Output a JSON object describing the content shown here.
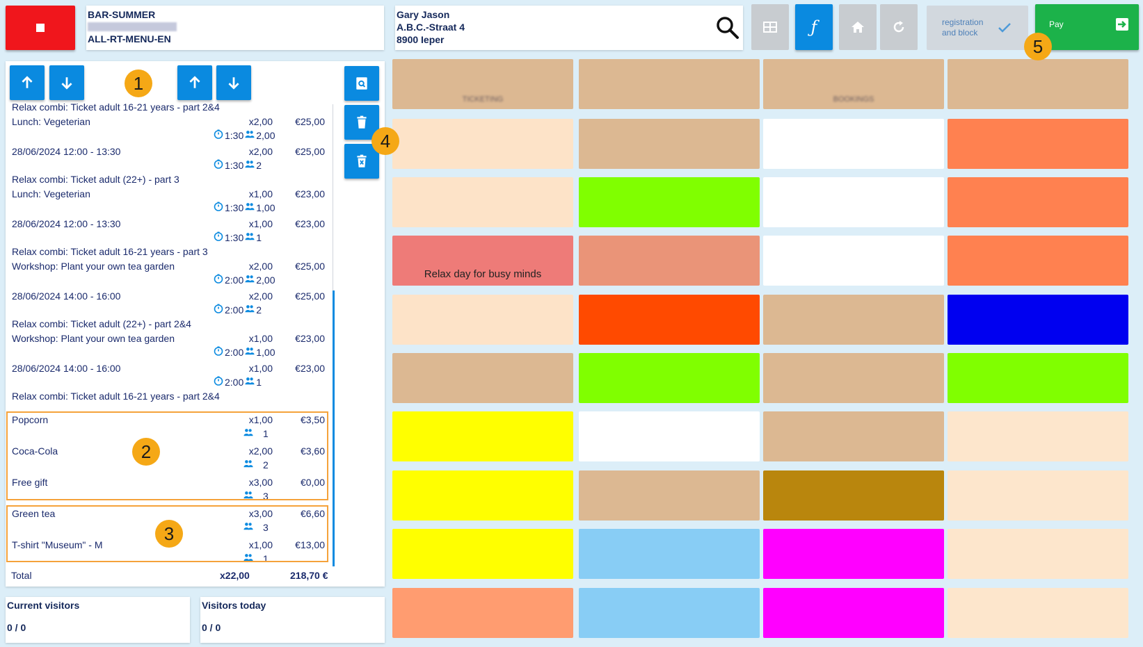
{
  "header": {
    "session_title": "BAR-SUMMER",
    "session_menu": "ALL-RT-MENU-EN",
    "customer_name": "Gary  Jason",
    "customer_street": "A.B.C.-Straat 4",
    "customer_city": "8900 Ieper",
    "registration_text_line1": "registration",
    "registration_text_line2": "and block",
    "pay_label": "Pay"
  },
  "order": {
    "lines": [
      {
        "label": "Relax combi: Ticket adult 16-21 years - part 2&4"
      },
      {
        "label": "Lunch: Vegeterian",
        "qty": "x2,00",
        "price": "€25,00",
        "time": "1:30",
        "persons": "2,00"
      },
      {
        "label": "28/06/2024 12:00 - 13:30",
        "qty": "x2,00",
        "price": "€25,00",
        "time": "1:30",
        "persons": "2"
      },
      {
        "label": "Relax combi: Ticket adult (22+) - part 3"
      },
      {
        "label": "Lunch: Vegeterian",
        "qty": "x1,00",
        "price": "€23,00",
        "time": "1:30",
        "persons": "1,00"
      },
      {
        "label": "28/06/2024 12:00 - 13:30",
        "qty": "x1,00",
        "price": "€23,00",
        "time": "1:30",
        "persons": "1"
      },
      {
        "label": "Relax combi: Ticket adult 16-21 years - part 3"
      },
      {
        "label": "Workshop: Plant your own tea garden",
        "qty": "x2,00",
        "price": "€25,00",
        "time": "2:00",
        "persons": "2,00"
      },
      {
        "label": "28/06/2024 14:00 - 16:00",
        "qty": "x2,00",
        "price": "€25,00",
        "time": "2:00",
        "persons": "2"
      },
      {
        "label": "Relax combi: Ticket adult (22+) - part 2&4"
      },
      {
        "label": "Workshop: Plant your own tea garden",
        "qty": "x1,00",
        "price": "€23,00",
        "time": "2:00",
        "persons": "1,00"
      },
      {
        "label": "28/06/2024 14:00 - 16:00",
        "qty": "x1,00",
        "price": "€23,00",
        "time": "2:00",
        "persons": "1"
      },
      {
        "label": "Relax combi: Ticket adult 16-21 years - part 2&4"
      }
    ],
    "group2": [
      {
        "label": "Popcorn",
        "qty": "x1,00",
        "price": "€3,50",
        "persons": "1"
      },
      {
        "label": "Coca-Cola",
        "qty": "x2,00",
        "price": "€3,60",
        "persons": "2"
      },
      {
        "label": "Free gift",
        "qty": "x3,00",
        "price": "€0,00",
        "persons": "3"
      }
    ],
    "group3": [
      {
        "label": "Green tea",
        "qty": "x3,00",
        "price": "€6,60",
        "persons": "3"
      },
      {
        "label": "T-shirt \"Museum\" - M",
        "qty": "x1,00",
        "price": "€13,00",
        "persons": "1"
      }
    ],
    "total_label": "Total",
    "total_qty": "x22,00",
    "total_amount": "218,70 €"
  },
  "visitors": {
    "current_label": "Current visitors",
    "current_value": "0 / 0",
    "today_label": "Visitors today",
    "today_value": "0 / 0"
  },
  "badges": [
    "1",
    "2",
    "3",
    "4",
    "5"
  ],
  "tiles": [
    {
      "label": "TICKETING",
      "color": "#dcb892"
    },
    {
      "label": "",
      "color": "#dcb892"
    },
    {
      "label": "BOOKINGS",
      "color": "#dcb892"
    },
    {
      "label": "",
      "color": "#dcb892"
    },
    {
      "label": "",
      "color": "#fde3c8"
    },
    {
      "label": "",
      "color": "#dcb892"
    },
    {
      "label": "",
      "color": "#ffffff"
    },
    {
      "label": "",
      "color": "#ff8150"
    },
    {
      "label": "",
      "color": "#fde3c8"
    },
    {
      "label": "",
      "color": "#80ff00"
    },
    {
      "label": "",
      "color": "#ffffff"
    },
    {
      "label": "",
      "color": "#ff8150"
    },
    {
      "label": "Relax day for busy minds",
      "color": "#ee7b78",
      "clear": true
    },
    {
      "label": "",
      "color": "#ea9478"
    },
    {
      "label": "",
      "color": "#ffffff"
    },
    {
      "label": "",
      "color": "#ff8150"
    },
    {
      "label": "",
      "color": "#fde3c8"
    },
    {
      "label": "",
      "color": "#ff4a00"
    },
    {
      "label": "",
      "color": "#dcb892"
    },
    {
      "label": "",
      "color": "#0000f0"
    },
    {
      "label": "",
      "color": "#dcb892"
    },
    {
      "label": "",
      "color": "#80ff00"
    },
    {
      "label": "",
      "color": "#dcb892"
    },
    {
      "label": "",
      "color": "#80ff00"
    },
    {
      "label": "",
      "color": "#ffff00"
    },
    {
      "label": "",
      "color": "#ffffff"
    },
    {
      "label": "",
      "color": "#dcb892"
    },
    {
      "label": "",
      "color": "#fde6cc"
    },
    {
      "label": "",
      "color": "#ffff00"
    },
    {
      "label": "",
      "color": "#dcb892"
    },
    {
      "label": "",
      "color": "#b9860d"
    },
    {
      "label": "",
      "color": "#fde6cc"
    },
    {
      "label": "",
      "color": "#ffff00"
    },
    {
      "label": "",
      "color": "#88cdf5"
    },
    {
      "label": "",
      "color": "#ff00ff"
    },
    {
      "label": "",
      "color": "#fde6cc"
    },
    {
      "label": "",
      "color": "#ff9c70"
    },
    {
      "label": "",
      "color": "#88cdf5"
    },
    {
      "label": "",
      "color": "#ff00ff"
    },
    {
      "label": "",
      "color": "#fde6cc"
    }
  ]
}
